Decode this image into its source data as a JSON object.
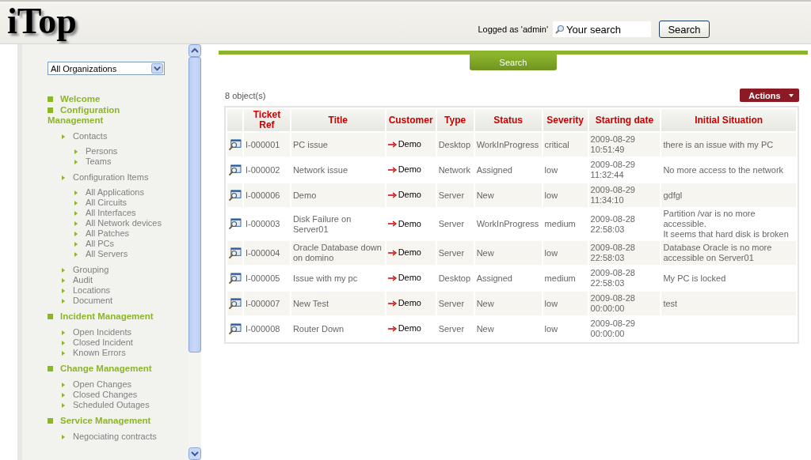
{
  "header": {
    "logo": "iTop",
    "logged_as": "Logged as 'admin'",
    "search": {
      "placeholder": "Your search"
    },
    "search_button": "Search"
  },
  "sidebar": {
    "organization": "All Organizations",
    "menu": [
      {
        "label": "Welcome"
      },
      {
        "label": "Configuration Management",
        "children": [
          {
            "label": "Contacts",
            "children": [
              {
                "label": "Persons"
              },
              {
                "label": "Teams"
              }
            ]
          },
          {
            "label": "Configuration Items",
            "children": [
              {
                "label": "All Applications"
              },
              {
                "label": "All Circuits"
              },
              {
                "label": "All Interfaces"
              },
              {
                "label": "All Network devices"
              },
              {
                "label": "All Patches"
              },
              {
                "label": "All PCs"
              },
              {
                "label": "All Servers"
              }
            ]
          },
          {
            "label": "Grouping"
          },
          {
            "label": "Audit"
          },
          {
            "label": "Locations"
          },
          {
            "label": "Document"
          }
        ]
      },
      {
        "label": "Incident Management",
        "children": [
          {
            "label": "Open Incidents"
          },
          {
            "label": "Closed Incident"
          },
          {
            "label": "Known Errors"
          }
        ]
      },
      {
        "label": "Change Management",
        "children": [
          {
            "label": "Open Changes"
          },
          {
            "label": "Closed Changes"
          },
          {
            "label": "Scheduled Outages"
          }
        ]
      },
      {
        "label": "Service Management",
        "children": [
          {
            "label": "Negociating contracts"
          }
        ]
      }
    ]
  },
  "content": {
    "search_tab": "Search",
    "count": "8 object(s)",
    "actions_button": "Actions",
    "table": {
      "columns": [
        "Ticket Ref",
        "Title",
        "Customer",
        "Type",
        "Status",
        "Severity",
        "Starting date",
        "Initial Situation"
      ],
      "rows": [
        {
          "ref": "I-000001",
          "title": "PC issue",
          "customer": "Demo",
          "type": "Desktop",
          "status": "WorkInProgress",
          "severity": "critical",
          "date": "2009-08-29 10:51:49",
          "situation": "there is an issue with my PC"
        },
        {
          "ref": "I-000002",
          "title": "Network issue",
          "customer": "Demo",
          "type": "Network",
          "status": "Assigned",
          "severity": "low",
          "date": "2009-08-29 11:32:44",
          "situation": "No more access to the network"
        },
        {
          "ref": "I-000006",
          "title": "Demo",
          "customer": "Demo",
          "type": "Server",
          "status": "New",
          "severity": "low",
          "date": "2009-08-29 11:34:10",
          "situation": "gdfgl"
        },
        {
          "ref": "I-000003",
          "title": "Disk Failure on Server01",
          "customer": "Demo",
          "type": "Server",
          "status": "WorkInProgress",
          "severity": "medium",
          "date": "2009-08-28 22:58:03",
          "situation": "Partition /var is no more accessible.\nIt seems that hard disk is broken"
        },
        {
          "ref": "I-000004",
          "title": "Oracle Database down on domino",
          "customer": "Demo",
          "type": "Server",
          "status": "New",
          "severity": "low",
          "date": "2009-08-28 22:58:03",
          "situation": "Database Oracle is no more accessible on Server01"
        },
        {
          "ref": "I-000005",
          "title": "Issue with my pc",
          "customer": "Demo",
          "type": "Desktop",
          "status": "Assigned",
          "severity": "medium",
          "date": "2009-08-28 22:58:03",
          "situation": "My PC is locked"
        },
        {
          "ref": "I-000007",
          "title": "New Test",
          "customer": "Demo",
          "type": "Server",
          "status": "New",
          "severity": "low",
          "date": "2009-08-28 00:00:00",
          "situation": "test"
        },
        {
          "ref": "I-000008",
          "title": "Router Down",
          "customer": "Demo",
          "type": "Server",
          "status": "New",
          "severity": "low",
          "date": "2009-08-29 00:00:00"
        }
      ]
    }
  }
}
